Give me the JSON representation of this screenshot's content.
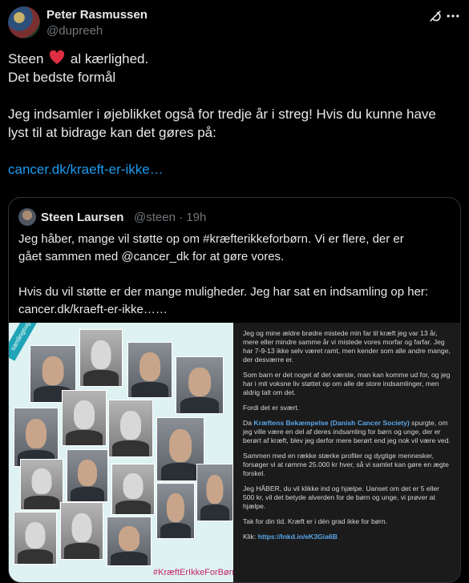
{
  "author": {
    "name": "Peter Rasmussen",
    "handle": "@dupreeh"
  },
  "icons": {
    "grok": "grok-icon",
    "more": "more-icon",
    "heart": "heart-icon"
  },
  "tweet": {
    "line1_before": "Steen",
    "line1_after": "al kærlighed.",
    "line2": "Det bedste formål",
    "para2_line1": "Jeg indsamler i øjeblikket også for tredje år i streg! Hvis du kunne have",
    "para2_line2": "lyst til at bidrage kan det gøres på:",
    "link": "cancer.dk/kraeft-er-ikke…"
  },
  "quote": {
    "name": "Steen Laursen",
    "handle": "@steen",
    "time": "19h",
    "line1": "Jeg håber, mange vil støtte op om #kræfterikkeforbørn. Vi er flere, der er",
    "line2": "gået sammen med @cancer_dk for at gøre vores.",
    "line3": "Hvis du vil støtte er der mange muligheder. Jeg har sat en indsamling op her:",
    "line4": "cancer.dk/kraeft-er-ikke……"
  },
  "media": {
    "ribbon": "samlingsugen",
    "hashtag": "#KræftErIkkeForBørn",
    "panel": {
      "p1": "Jeg og mine ældre brødre mistede min far til kræft jeg var 13 år, mere eller mindre samme år vi mistede vores morfar og farfar. Jeg har 7-9-13 ikke selv været ramt, men kender som alle andre mange, der desværre er.",
      "p2": "Som barn er det noget af det værste, man kan komme ud for, og jeg har i mit voksne liv støttet op om alle de store indsamlinger, men aldrig talt om det.",
      "p3": "Fordi det er svært.",
      "p4_prefix": "Da",
      "p4_org": "Kræftens Bekæmpelse (Danish Cancer Society)",
      "p4_rest": "spurgte, om jeg ville være en del af deres indsamling for børn og unge, der er berørt af kræft, blev jeg derfor mere berørt end jeg nok vil være ved.",
      "p5": "Sammen med en række stærke profiler og dygtige mennesker, forsøger vi at rømme 25.000 kr hver, så vi samlet kan gøre en ægte forskel.",
      "p6": "Jeg HÅBER, du vil klikke ind og hjælpe. Uanset om det er 5 eller 500 kr, vil det betyde alverden for de børn og unge, vi prøver at hjælpe.",
      "p7": "Tak for din tid. Kræft er i dén grad ikke for børn.",
      "klik_label": "Klik:",
      "klik_link": "https://lnkd.in/eK3Gia6B"
    }
  },
  "colors": {
    "background": "#000000",
    "text": "#e7e9ea",
    "secondary": "#71767b",
    "link": "#1d9bf0",
    "border": "#2f3336",
    "heart": "#f91880"
  }
}
